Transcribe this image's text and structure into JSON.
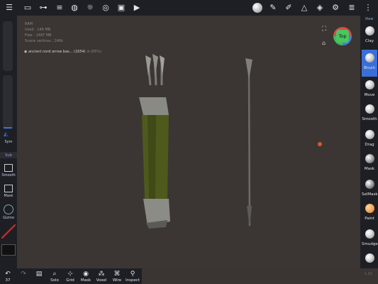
{
  "stats": {
    "ram_label": "RAM",
    "used": "Used : 146 MB",
    "free": "Free : 1487 MB",
    "vertices": "Scene vertices : 246k"
  },
  "scene_item": {
    "name": "ancient nord arrow bas... (1654)",
    "opacity": "(65%)"
  },
  "gizmo": {
    "label": "Top"
  },
  "left_panel": {
    "sym": "Sym",
    "sub": "Sub",
    "smooth": "Smooth",
    "mask": "Mask",
    "gizmo": "Gizmo"
  },
  "right_tools": {
    "view": "View",
    "items": [
      "Clay",
      "Brush",
      "Move",
      "Smooth",
      "Drag",
      "Mask",
      "SelMask",
      "Paint",
      "Smudge"
    ]
  },
  "bottom_tools": {
    "undo_count": "37",
    "items": [
      "Solo",
      "Grid",
      "Mask",
      "Voxel",
      "Wire",
      "Inspect"
    ]
  },
  "corner_text": "1.81",
  "colors": {
    "accent": "#3a6fd8",
    "bar": "#1e1f24",
    "viewport": "#3b3633",
    "dot": "#d65a2a"
  }
}
